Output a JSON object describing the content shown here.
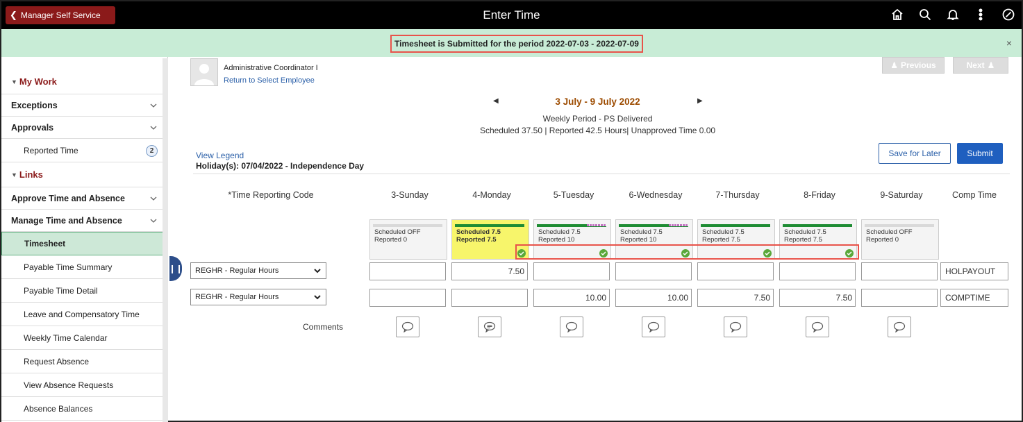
{
  "topbar": {
    "back_label": "Manager Self Service",
    "title": "Enter Time",
    "icons": [
      "home-icon",
      "search-icon",
      "bell-icon",
      "more-icon",
      "navbar-icon"
    ]
  },
  "banner": {
    "message": "Timesheet is Submitted for the period 2022-07-03 - 2022-07-09",
    "close": "×"
  },
  "sidebar": {
    "my_work": "My Work",
    "exceptions": "Exceptions",
    "approvals": "Approvals",
    "reported_time": "Reported Time",
    "reported_time_count": "2",
    "links": "Links",
    "approve_time": "Approve Time and Absence",
    "manage_time": "Manage Time and Absence",
    "items": [
      "Timesheet",
      "Payable Time Summary",
      "Payable Time Detail",
      "Leave and Compensatory Time",
      "Weekly Time Calendar",
      "Request Absence",
      "View Absence Requests",
      "Absence Balances"
    ]
  },
  "employee": {
    "title": "Administrative Coordinator I",
    "return_link": "Return to Select Employee",
    "previous": "Previous",
    "next": "Next"
  },
  "period": {
    "range": "3 July - 9 July 2022",
    "type": "Weekly Period - PS Delivered",
    "stats": "Scheduled  37.50 | Reported  42.5 Hours| Unapproved Time  0.00"
  },
  "actions": {
    "view_legend": "View Legend",
    "holiday": "Holiday(s): 07/04/2022 - Independence Day",
    "save_later": "Save for Later",
    "submit": "Submit"
  },
  "grid": {
    "trc_header": "*Time Reporting Code",
    "days": [
      {
        "header": "3-Sunday",
        "scheduled": "Scheduled OFF",
        "reported": "Reported  0"
      },
      {
        "header": "4-Monday",
        "scheduled": "Scheduled 7.5",
        "reported": "Reported  7.5"
      },
      {
        "header": "5-Tuesday",
        "scheduled": "Scheduled 7.5",
        "reported": "Reported  10"
      },
      {
        "header": "6-Wednesday",
        "scheduled": "Scheduled 7.5",
        "reported": "Reported  10"
      },
      {
        "header": "7-Thursday",
        "scheduled": "Scheduled 7.5",
        "reported": "Reported  7.5"
      },
      {
        "header": "8-Friday",
        "scheduled": "Scheduled 7.5",
        "reported": "Reported  7.5"
      },
      {
        "header": "9-Saturday",
        "scheduled": "Scheduled OFF",
        "reported": "Reported  0"
      }
    ],
    "comp_header": "Comp Time",
    "rows": [
      {
        "trc": "REGHR - Regular Hours",
        "hours": [
          "",
          "7.50",
          "",
          "",
          "",
          "",
          ""
        ],
        "comp": "HOLPAYOUT"
      },
      {
        "trc": "REGHR - Regular Hours",
        "hours": [
          "",
          "",
          "10.00",
          "10.00",
          "7.50",
          "7.50",
          ""
        ],
        "comp": "COMPTIME"
      }
    ],
    "comments_label": "Comments"
  },
  "colors": {
    "topbar": "#000000",
    "back_button": "#8b1a1a",
    "banner": "#c8ecd6",
    "highlight": "#e8534a",
    "submit": "#1f5fbf",
    "scheduled_bar": "#1e8c33",
    "monday_card": "#f7f56b"
  }
}
